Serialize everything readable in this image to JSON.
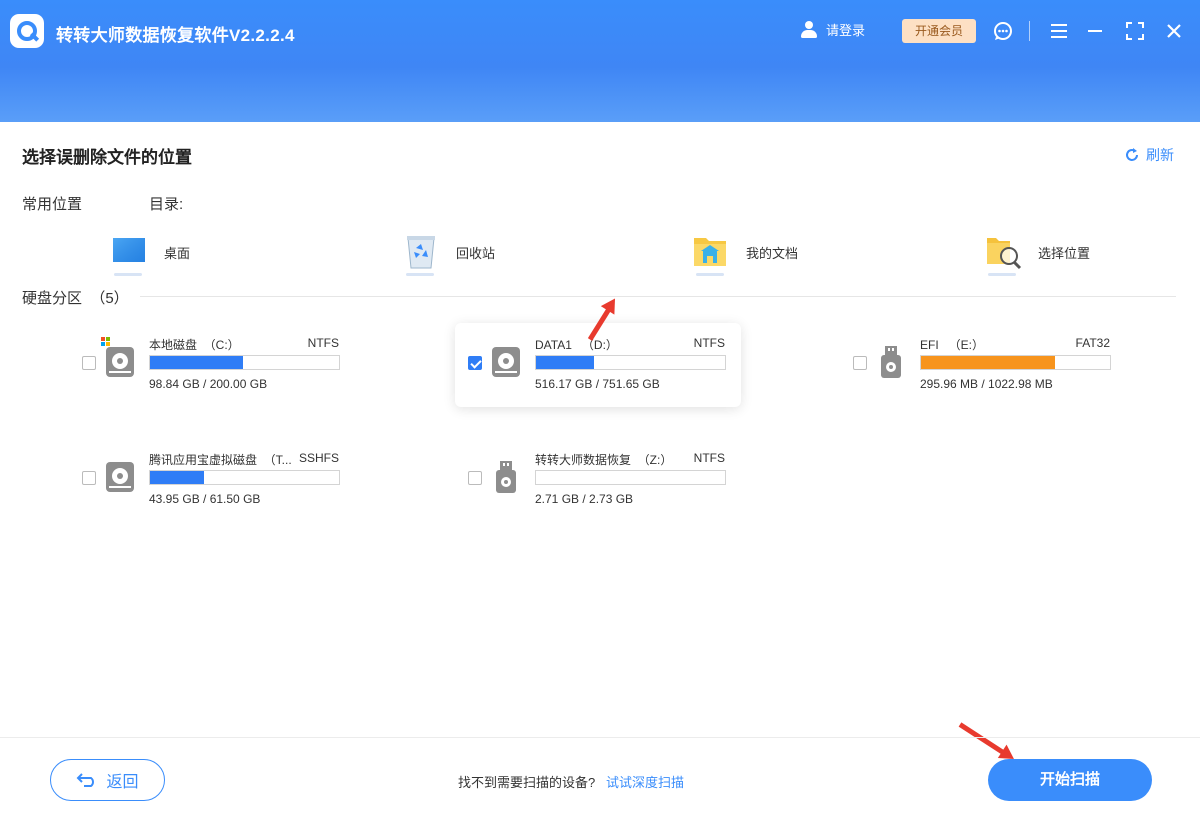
{
  "header": {
    "title": "转转大师数据恢复软件V2.2.2.4",
    "login_label": "请登录",
    "vip_label": "开通会员",
    "icons": [
      "logo-icon",
      "user-icon",
      "support-icon",
      "menu-icon",
      "minimize-icon",
      "maximize-icon",
      "close-icon"
    ]
  },
  "main": {
    "title": "选择误删除文件的位置",
    "refresh_label": "刷新",
    "common_label": "常用位置",
    "dir_label": "目录:",
    "locations": [
      {
        "label": "桌面",
        "icon": "desktop-icon"
      },
      {
        "label": "回收站",
        "icon": "recycle-bin-icon"
      },
      {
        "label": "我的文档",
        "icon": "documents-folder-icon"
      },
      {
        "label": "选择位置",
        "icon": "choose-location-icon"
      }
    ],
    "disk_label": "硬盘分区  （5）",
    "disks": [
      {
        "name": "本地磁盘  （C:）",
        "fs": "NTFS",
        "size": "98.84 GB / 200.00 GB",
        "used": 0.494,
        "color": "#2f7df6",
        "icon": "hard-disk-icon",
        "checked": false
      },
      {
        "name": "DATA1   （D:）",
        "fs": "NTFS",
        "size": "516.17 GB / 751.65 GB",
        "used": 0.305,
        "color": "#2f7df6",
        "icon": "hard-disk-icon",
        "checked": true
      },
      {
        "name": "EFI   （E:）",
        "fs": "FAT32",
        "size": "295.96 MB / 1022.98 MB",
        "used": 0.71,
        "color": "#f7941d",
        "icon": "usb-drive-icon",
        "checked": false
      },
      {
        "name": "腾讯应用宝虚拟磁盘  （T...",
        "fs": "SSHFS",
        "size": "43.95 GB / 61.50 GB",
        "used": 0.285,
        "color": "#2f7df6",
        "icon": "hard-disk-icon",
        "checked": false
      },
      {
        "name": "转转大师数据恢复  （Z:）",
        "fs": "NTFS",
        "size": "2.71 GB / 2.73 GB",
        "used": 0.0,
        "color": "#2f7df6",
        "icon": "usb-drive-icon",
        "checked": false
      }
    ]
  },
  "footer": {
    "back_label": "返回",
    "hint": "找不到需要扫描的设备?",
    "deep_scan_link": "试试深度扫描",
    "start_label": "开始扫描"
  }
}
